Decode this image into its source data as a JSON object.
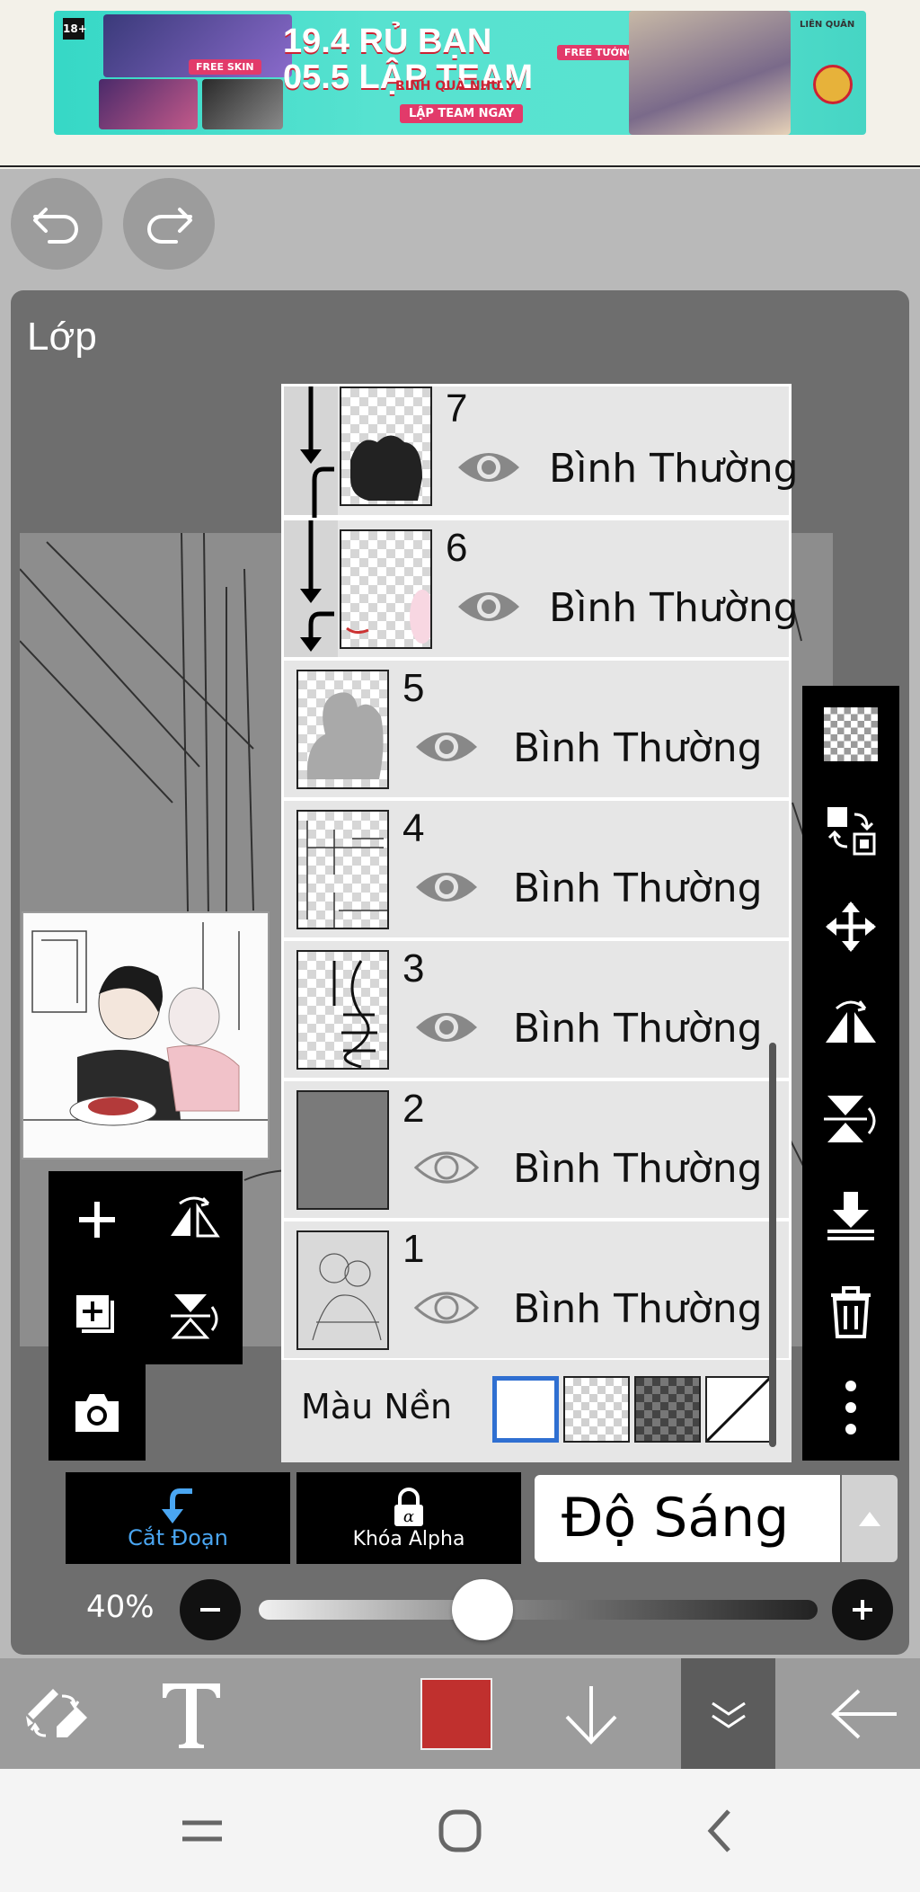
{
  "ad": {
    "age_badge": "18+",
    "headline_line1": "19.4 RỦ BẠN",
    "headline_line2": "05.5 LẬP TEAM",
    "tagline": "RINH QUÀ NHƯ Ý",
    "cta": "LẬP TEAM NGAY",
    "chip_free_skin": "FREE SKIN",
    "chip_free_hero": "FREE TƯỚNG MỚI",
    "brand": "LIÊN QUÂN"
  },
  "toolbar_top": {
    "undo_icon": "undo-arrow",
    "redo_icon": "redo-arrow"
  },
  "panel": {
    "title": "Lớp"
  },
  "layers": [
    {
      "number": "7",
      "visible": true,
      "blend": "Bình Thường",
      "clipped": true
    },
    {
      "number": "6",
      "visible": true,
      "blend": "Bình Thường",
      "clipped": true
    },
    {
      "number": "5",
      "visible": true,
      "blend": "Bình Thường",
      "clipped": false
    },
    {
      "number": "4",
      "visible": true,
      "blend": "Bình Thường",
      "clipped": false
    },
    {
      "number": "3",
      "visible": true,
      "blend": "Bình Thường",
      "clipped": false
    },
    {
      "number": "2",
      "visible": false,
      "blend": "Bình Thường",
      "clipped": false
    },
    {
      "number": "1",
      "visible": false,
      "blend": "Bình Thường",
      "clipped": false
    }
  ],
  "background": {
    "label": "Màu Nền",
    "options": [
      "white",
      "transparent-light",
      "transparent-dark",
      "none"
    ],
    "selected": "white"
  },
  "layer_modes": {
    "clip_label": "Cắt Đoạn",
    "alpha_label": "Khóa Alpha",
    "blend_mode": "Độ Sáng"
  },
  "opacity": {
    "label": "40%",
    "value": 0.4
  },
  "colors": {
    "current_color": "#c0302e",
    "clip_active": "#4aa6f2",
    "selection_blue": "#2f6fd1"
  }
}
